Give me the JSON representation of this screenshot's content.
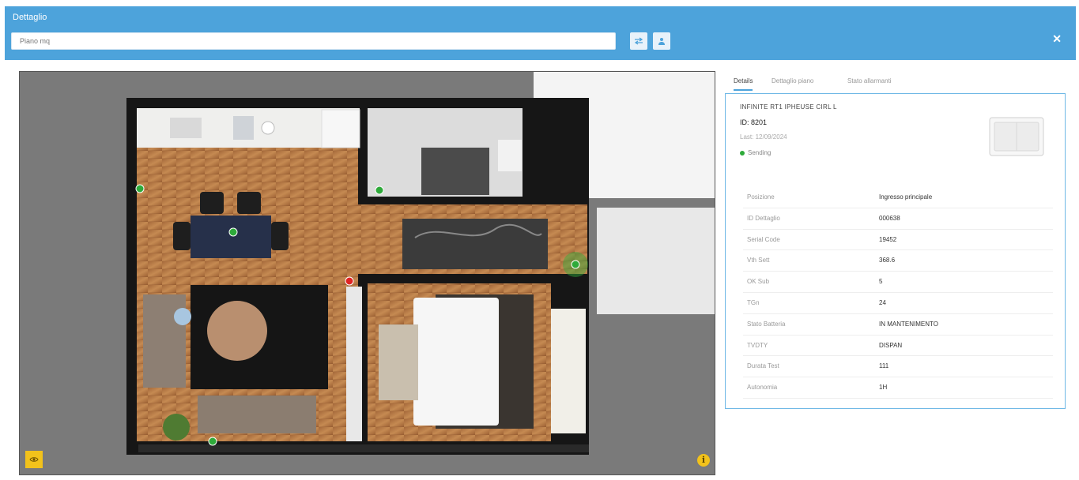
{
  "header": {
    "title": "Dettaglio",
    "search_value": "Piano mq"
  },
  "tabs": [
    {
      "label": "Details"
    },
    {
      "label": "Dettaglio piano"
    },
    {
      "label": "Stato allarmanti"
    }
  ],
  "device": {
    "name": "INFINITE RT1 IPHEUSE CIRL L",
    "id": "ID: 8201",
    "last": "Last: 12/09/2024",
    "status": "Sending"
  },
  "properties": [
    {
      "label": "Posizione",
      "value": "Ingresso principale"
    },
    {
      "label": "ID Dettaglio",
      "value": "000638"
    },
    {
      "label": "Serial Code",
      "value": "19452"
    },
    {
      "label": "Vth Sett",
      "value": "368.6"
    },
    {
      "label": "OK Sub",
      "value": "5"
    },
    {
      "label": "TGn",
      "value": "24"
    },
    {
      "label": "Stato Batteria",
      "value": "IN MANTENIMENTO"
    },
    {
      "label": "TVDTY",
      "value": "DISPAN"
    },
    {
      "label": "Durata Test",
      "value": "111"
    },
    {
      "label": "Autonomia",
      "value": "1H"
    }
  ],
  "colors": {
    "header": "#4da3db",
    "accent": "#f2c21b",
    "status_on": "#2eaa3a",
    "marker_alert": "#e02424"
  },
  "icons": {
    "view_mode": "eye-icon",
    "info": "info-icon",
    "close": "close-icon",
    "toolbar_1": "swap-icon",
    "toolbar_2": "user-icon"
  }
}
